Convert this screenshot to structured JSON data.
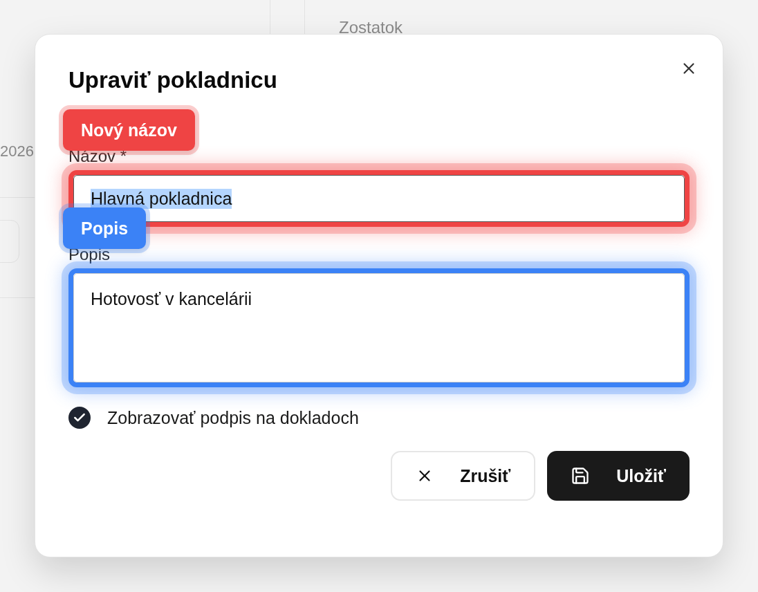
{
  "background": {
    "column_heading": "Zostatok",
    "date_fragment": "2026"
  },
  "dialog": {
    "title": "Upraviť pokladnicu",
    "fields": [
      {
        "kind": "input",
        "label": "Názov *",
        "value": "Hlavná pokladnica",
        "selected": true,
        "highlight": {
          "label": "Nový názov",
          "color": "#ef4444"
        }
      },
      {
        "kind": "textarea",
        "label": "Popis",
        "value": "Hotovosť v kancelárii",
        "selected": false,
        "highlight": {
          "label": "Popis",
          "color": "#3b82f6"
        }
      }
    ],
    "checkbox": {
      "label": "Zobrazovať podpis na dokladoch",
      "checked": true
    },
    "buttons": [
      {
        "kind": "cancel",
        "label": "Zrušiť"
      },
      {
        "kind": "save",
        "label": "Uložiť"
      }
    ]
  }
}
